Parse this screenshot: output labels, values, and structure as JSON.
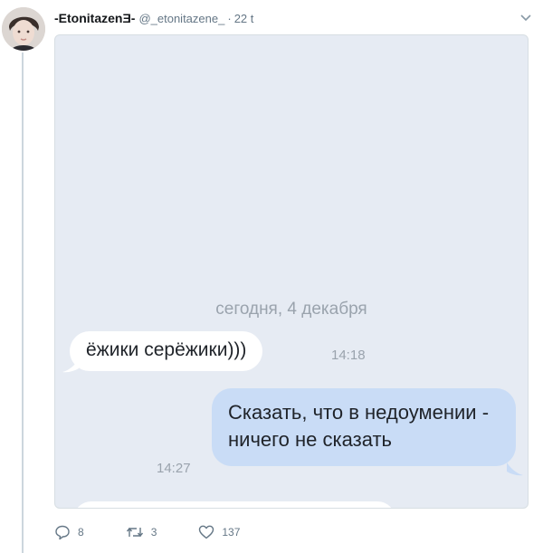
{
  "tweet": {
    "display_name": "-EtonitazenƎ-",
    "handle": "@_etonitazene_",
    "separator": "·",
    "time": "22 t"
  },
  "chat": {
    "date_separator": "сегодня, 4 декабря",
    "incoming": {
      "text": "ёжики серёжики)))",
      "time": "14:18"
    },
    "outgoing": {
      "text": "Сказать, что в недоумении - ничего не сказать",
      "time": "14:27"
    }
  },
  "actions": {
    "replies": "8",
    "retweets": "3",
    "likes": "137"
  },
  "colors": {
    "chat_background": "#e6ebf3",
    "outgoing_bubble": "#c9dcf6",
    "incoming_bubble": "#ffffff",
    "meta_text": "#657786"
  },
  "icons": [
    "avatar",
    "chevron-down-icon",
    "reply-icon",
    "retweet-icon",
    "like-icon"
  ]
}
